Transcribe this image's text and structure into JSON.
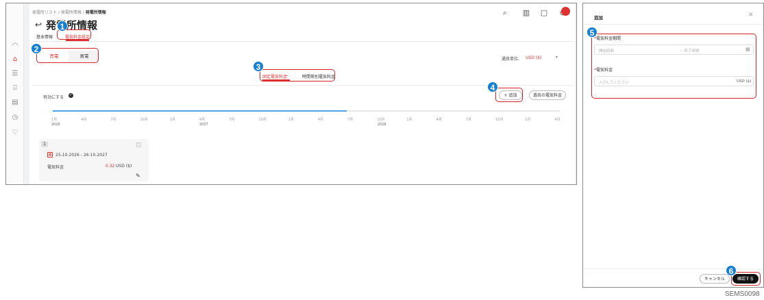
{
  "breadcrumb": {
    "item1": "発電所リスト",
    "sep": "/",
    "item2": "発電所情報",
    "item3": "発電所情報"
  },
  "toolbar_icons": [
    "search-icon",
    "building-icon",
    "message-icon",
    "globe-icon",
    "avatar"
  ],
  "page_title": "発電所情報",
  "tabs": {
    "basic": "基本情報",
    "price": "電気料金設定"
  },
  "mode": {
    "sell": "売電",
    "buy": "買電",
    "selected": "sell"
  },
  "currency": {
    "label": "通貨単位:",
    "value": "USD ($)"
  },
  "price_type": {
    "fixed": "固定電気料金",
    "time": "時間帯別電気料金",
    "selected": "fixed"
  },
  "enable": {
    "label": "有効にする"
  },
  "buttons": {
    "add": "+ 追加",
    "past": "過去の電気料金"
  },
  "timeline": {
    "progress": 0.58,
    "months": [
      "1月",
      "4月",
      "7月",
      "10月",
      "1月",
      "4月",
      "7月",
      "10月",
      "1月",
      "4月",
      "7月",
      "10月",
      "1月",
      "4月",
      "7月",
      "10月",
      "1月",
      "4月",
      "7月"
    ],
    "years": [
      "2026",
      "2027",
      "2028"
    ]
  },
  "card": {
    "index": "1",
    "date_range": "25-10-2026 - 26-10-2027",
    "price_label": "電気料金",
    "price_value": "0.32",
    "price_unit": "USD ($)"
  },
  "panel": {
    "title": "追加",
    "period_label": "電気料金期間",
    "start_placeholder": "開始時間",
    "end_placeholder": "~ 終了時間",
    "price_label": "電気料金",
    "price_placeholder": "入力してください",
    "unit": "USD ($)",
    "cancel": "キャンセル",
    "confirm": "確認する"
  },
  "annotations": [
    "1",
    "2",
    "3",
    "4",
    "5",
    "6"
  ],
  "footer_code": "SEMS0098",
  "colors": {
    "accent": "#e03131",
    "highlight": "#d9232b",
    "badge": "#1680d0",
    "progress": "#4aa3e8"
  }
}
